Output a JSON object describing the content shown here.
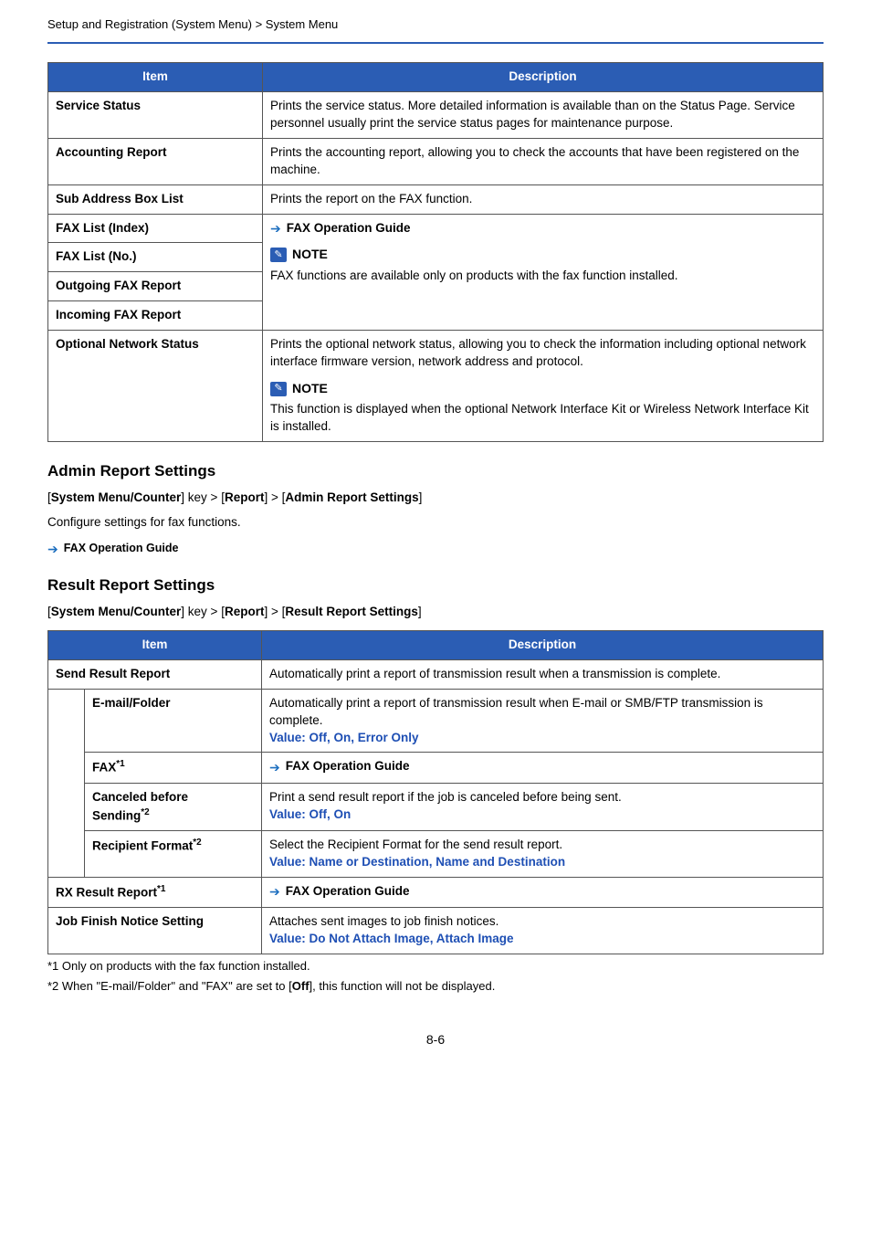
{
  "breadcrumb": "Setup and Registration (System Menu) > System Menu",
  "table1": {
    "headers": {
      "item": "Item",
      "desc": "Description"
    },
    "rows": {
      "service_status": {
        "item": "Service Status",
        "desc": "Prints the service status. More detailed information is available than on the Status Page. Service personnel usually print the service status pages for maintenance purpose."
      },
      "accounting_report": {
        "item": "Accounting Report",
        "desc": "Prints the accounting report, allowing you to check the accounts that have been registered on the machine."
      },
      "sub_address": {
        "item": "Sub Address Box List",
        "desc": "Prints the report on the FAX function."
      },
      "fax_index": {
        "item": "FAX List (Index)"
      },
      "fax_no": {
        "item": "FAX List (No.)"
      },
      "outgoing": {
        "item": "Outgoing FAX Report"
      },
      "incoming": {
        "item": "Incoming FAX Report"
      },
      "optional_network": {
        "item": "Optional Network Status",
        "desc1": "Prints the optional network status, allowing you to check the information including optional network interface firmware version, network address and protocol.",
        "desc2": "This function is displayed when the optional Network Interface Kit or Wireless Network Interface Kit is installed."
      }
    },
    "labels": {
      "fax_guide": "FAX Operation Guide",
      "note": "NOTE",
      "note_fax": "FAX functions are available only on products with the fax function installed."
    }
  },
  "admin_section": {
    "title": "Admin Report Settings",
    "path_prefix": "[",
    "path1": "System Menu/Counter",
    "path_mid1": "] key > [",
    "path2": "Report",
    "path_mid2": "] > [",
    "path3": "Admin Report Settings",
    "path_suffix": "]",
    "body": "Configure settings for fax functions.",
    "link": "FAX Operation Guide"
  },
  "result_section": {
    "title": "Result Report Settings",
    "path1": "System Menu/Counter",
    "path_mid1": "] key > [",
    "path2": "Report",
    "path_mid2": "] > [",
    "path3": "Result Report Settings"
  },
  "table2": {
    "headers": {
      "item": "Item",
      "desc": "Description"
    },
    "rows": {
      "send": {
        "item": "Send Result Report",
        "desc": "Automatically print a report of transmission result when a transmission is complete."
      },
      "email": {
        "item": "E-mail/Folder",
        "desc": "Automatically print a report of transmission result when E-mail or SMB/FTP transmission is complete.",
        "value_label": "Value",
        "value": ": Off, On, Error Only"
      },
      "fax": {
        "item_base": "FAX",
        "item_sup": "*1",
        "link": "FAX Operation Guide"
      },
      "canceled": {
        "item_l1": "Canceled before",
        "item_l2_base": "Sending",
        "item_l2_sup": "*2",
        "desc": "Print a send result report if the job is canceled before being sent.",
        "value_label": "Value",
        "value": ": Off, On"
      },
      "recipient": {
        "item_base": "Recipient Format",
        "item_sup": "*2",
        "desc": "Select the Recipient Format for the send result report.",
        "value_label": "Value",
        "value": ": Name or Destination, Name and Destination"
      },
      "rx": {
        "item_base": "RX Result Report",
        "item_sup": "*1",
        "link": "FAX Operation Guide"
      },
      "job_finish": {
        "item": "Job Finish Notice Setting",
        "desc": "Attaches sent images to job finish notices.",
        "value_label": "Value",
        "value": ": Do Not Attach Image, Attach Image"
      }
    }
  },
  "footnotes": {
    "f1_prefix": "*1   ",
    "f1": "Only on products with the fax function installed.",
    "f2_prefix": "*2   ",
    "f2_a": "When \"E-mail/Folder\" and \"FAX\" are set to [",
    "f2_bold": "Off",
    "f2_b": "], this function will not be displayed."
  },
  "page_number": "8-6"
}
